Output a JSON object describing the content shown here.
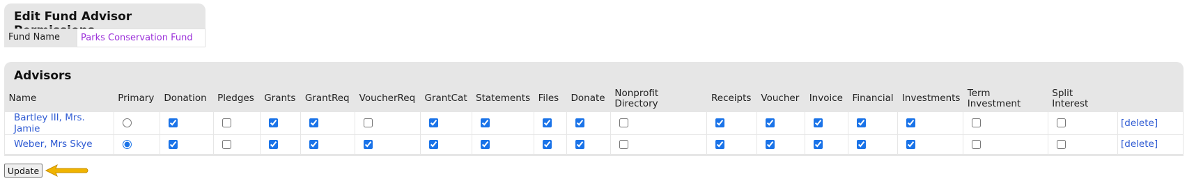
{
  "edit_panel": {
    "title": "Edit Fund Advisor Permissions",
    "fund_name_label": "Fund Name",
    "fund_name_value": "Parks Conservation Fund"
  },
  "advisors": {
    "title": "Advisors",
    "columns": {
      "name": "Name",
      "primary": "Primary",
      "donation": "Donation",
      "pledges": "Pledges",
      "grants": "Grants",
      "grantreq": "GrantReq",
      "voucherreq": "VoucherReq",
      "grantcat": "GrantCat",
      "statements": "Statements",
      "files": "Files",
      "donate": "Donate",
      "nonprofit_directory": "Nonprofit Directory",
      "receipts": "Receipts",
      "voucher": "Voucher",
      "invoice": "Invoice",
      "financial": "Financial",
      "investments": "Investments",
      "term_investment": "Term Investment",
      "split_interest": "Split Interest"
    },
    "rows": [
      {
        "name": "Bartley III, Mrs. Jamie",
        "primary": false,
        "donation": true,
        "pledges": false,
        "grants": true,
        "grantreq": true,
        "voucherreq": false,
        "grantcat": true,
        "statements": true,
        "files": true,
        "donate": true,
        "nonprofit_directory": false,
        "receipts": true,
        "voucher": true,
        "invoice": true,
        "financial": true,
        "investments": true,
        "term_investment": false,
        "split_interest": false,
        "delete_label": "[delete]"
      },
      {
        "name": "Weber, Mrs Skye",
        "primary": true,
        "donation": true,
        "pledges": false,
        "grants": true,
        "grantreq": true,
        "voucherreq": true,
        "grantcat": true,
        "statements": true,
        "files": true,
        "donate": true,
        "nonprofit_directory": false,
        "receipts": true,
        "voucher": true,
        "invoice": true,
        "financial": true,
        "investments": true,
        "term_investment": false,
        "split_interest": false,
        "delete_label": "[delete]"
      }
    ]
  },
  "update_button_label": "Update",
  "colors": {
    "panel_bg": "#e6e6e6",
    "link": "#2f5bd3",
    "fund_value": "#9b30d9",
    "arrow": "#f0b400"
  },
  "icons": {
    "pointer": "arrow-left-icon"
  }
}
